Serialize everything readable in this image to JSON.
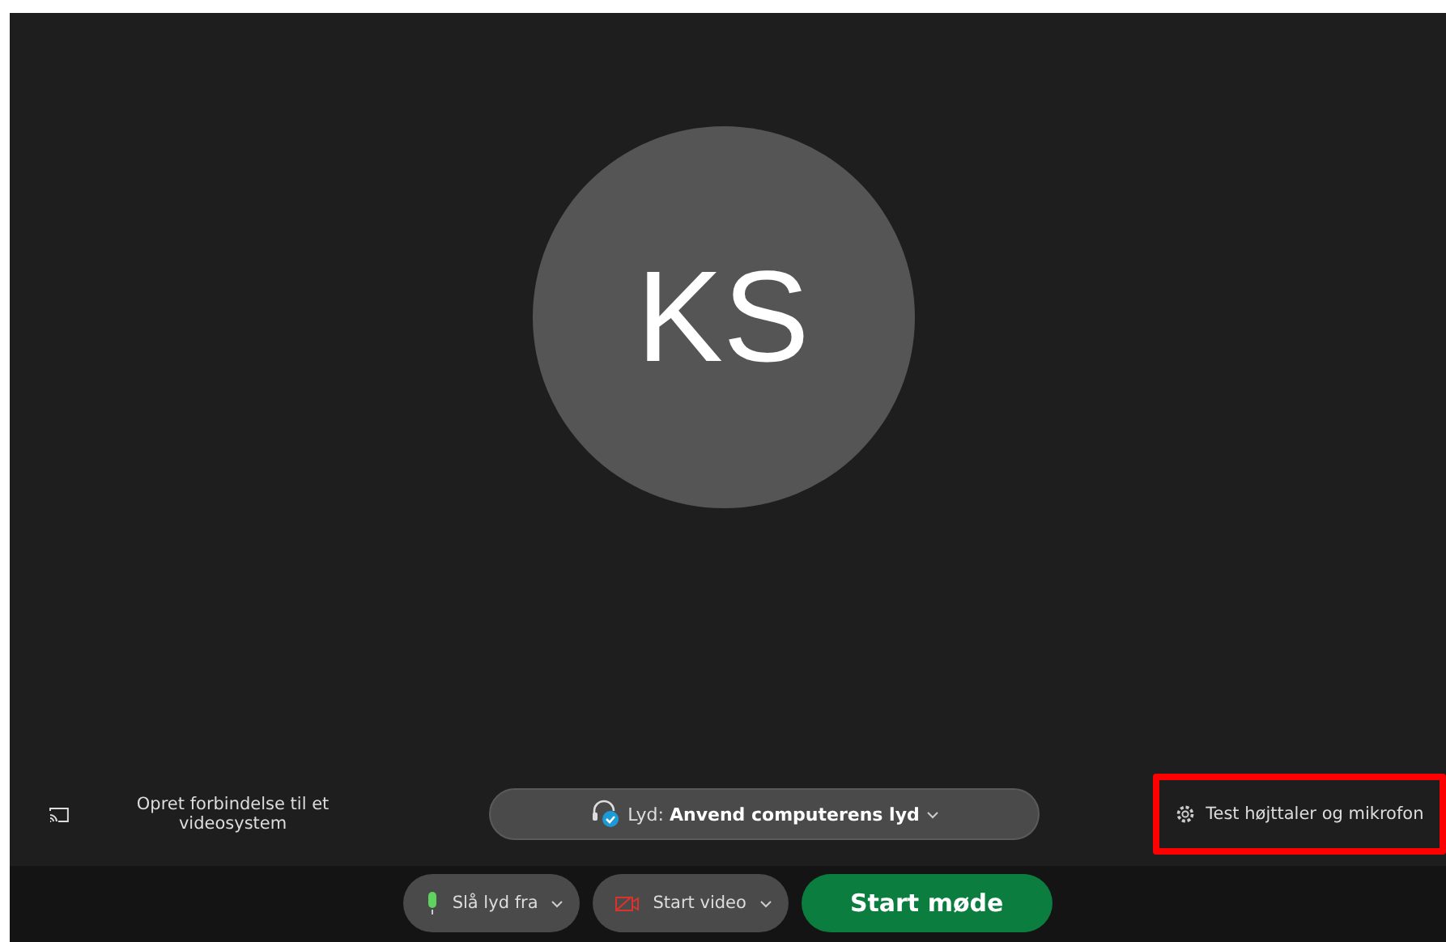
{
  "avatar": {
    "initials": "KS"
  },
  "connect_video_system": {
    "label": "Opret forbindelse til et videosystem"
  },
  "audio": {
    "label": "Lyd:",
    "value": "Anvend computerens lyd"
  },
  "test_audio": {
    "label": "Test højttaler og mikrofon",
    "highlighted": true
  },
  "controls": [
    {
      "kind": "mute",
      "label": "Slå lyd fra"
    },
    {
      "kind": "video",
      "label": "Start video"
    },
    {
      "kind": "start",
      "label": "Start møde"
    }
  ]
}
